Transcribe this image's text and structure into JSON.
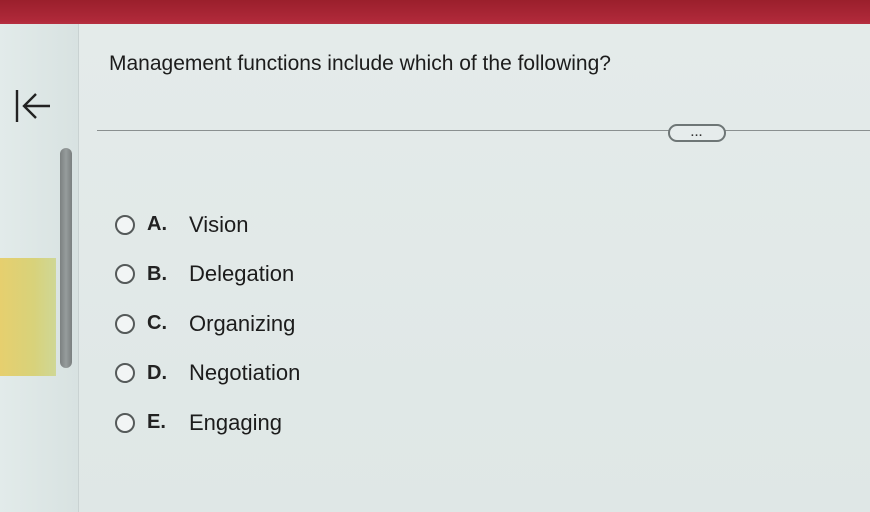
{
  "question": {
    "text": "Management functions include which of the following?"
  },
  "more_button": {
    "label": "..."
  },
  "icons": {
    "collapse": "collapse-left-icon"
  },
  "options": [
    {
      "letter": "A.",
      "label": "Vision"
    },
    {
      "letter": "B.",
      "label": "Delegation"
    },
    {
      "letter": "C.",
      "label": "Organizing"
    },
    {
      "letter": "D.",
      "label": "Negotiation"
    },
    {
      "letter": "E.",
      "label": "Engaging"
    }
  ],
  "colors": {
    "top_bar": "#b0293a",
    "highlight": "#e6cf6e",
    "background": "#e4ebea"
  }
}
